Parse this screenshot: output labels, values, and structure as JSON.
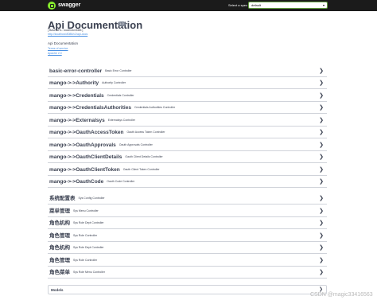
{
  "topbar": {
    "logo_text": "swagger",
    "select_label": "Select a spec",
    "select_value": "default",
    "caret": "▾"
  },
  "info": {
    "title": "Api Documentation",
    "version": "1.0",
    "base_url": "[ Base URL: localhost:8088 ]",
    "spec_url": "http://localhost:8088/v2/api-docs",
    "description": "Api Documentation",
    "terms": "Terms of service",
    "license": "Apache 2.0"
  },
  "tags": [
    {
      "name": "basic-error-controller",
      "desc": "Basic Error Controller"
    },
    {
      "name": "mango->->Authority",
      "desc": "Authority Controller"
    },
    {
      "name": "mango->->Credentials",
      "desc": "Credentials Controller"
    },
    {
      "name": "mango->->CredentialsAuthorities",
      "desc": "Credentials Authorities Controller"
    },
    {
      "name": "mango->->Externalsys",
      "desc": "Externalsys Controller"
    },
    {
      "name": "mango->->OauthAccessToken",
      "desc": "Oauth Access Token Controller"
    },
    {
      "name": "mango->->OauthApprovals",
      "desc": "Oauth Approvals Controller"
    },
    {
      "name": "mango->->OauthClientDetails",
      "desc": "Oauth Client Details Controller"
    },
    {
      "name": "mango->->OauthClientToken",
      "desc": "Oauth Client Token Controller"
    },
    {
      "name": "mango->->OauthCode",
      "desc": "Oauth Code Controller"
    },
    {
      "name": "系统配置表",
      "desc": "Sys Config Controller"
    },
    {
      "name": "菜单管理",
      "desc": "Sys Menu Controller"
    },
    {
      "name": "角色机构",
      "desc": "Sys Role Dept Controller"
    },
    {
      "name": "角色管理",
      "desc": "Sys Role Controller"
    },
    {
      "name": "角色机构",
      "desc": "Sys Role Dept Controller"
    },
    {
      "name": "角色管理",
      "desc": "Sys Role Controller"
    },
    {
      "name": "角色菜单",
      "desc": "Sys Role Menu Controller"
    }
  ],
  "chevron": "❯",
  "models": {
    "label": "Models"
  },
  "watermark": "CSDN @magic33416563"
}
